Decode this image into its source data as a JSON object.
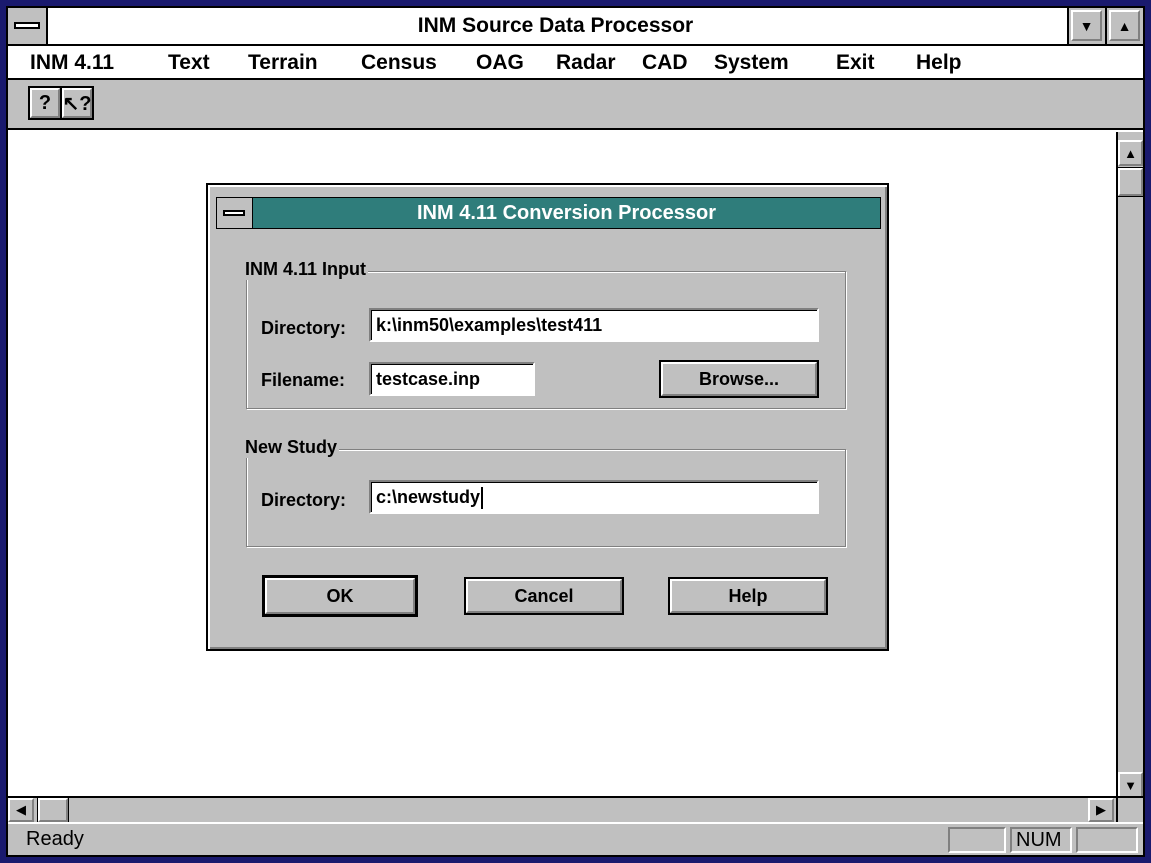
{
  "window": {
    "title": "INM Source Data Processor",
    "minimize_glyph": "▼",
    "maximize_glyph": "▲"
  },
  "menu": {
    "items": [
      "INM 4.11",
      "Text",
      "Terrain",
      "Census",
      "OAG",
      "Radar",
      "CAD",
      "System",
      "Exit",
      "Help"
    ]
  },
  "toolbar": {
    "help_glyph": "?",
    "context_help_glyph": "↖?"
  },
  "scrollbars": {
    "up_glyph": "▲",
    "down_glyph": "▼",
    "left_glyph": "◀",
    "right_glyph": "▶"
  },
  "dialog": {
    "title": "INM 4.11 Conversion Processor",
    "input_group": {
      "label": "INM 4.11 Input",
      "directory_label": "Directory:",
      "directory_value": "k:\\inm50\\examples\\test411",
      "filename_label": "Filename:",
      "filename_value": "testcase.inp",
      "browse_label": "Browse..."
    },
    "study_group": {
      "label": "New Study",
      "directory_label": "Directory:",
      "directory_value": "c:\\newstudy"
    },
    "buttons": {
      "ok": "OK",
      "cancel": "Cancel",
      "help": "Help"
    },
    "title_color": "#2f7d7b"
  },
  "statusbar": {
    "text": "Ready",
    "num": "NUM"
  }
}
